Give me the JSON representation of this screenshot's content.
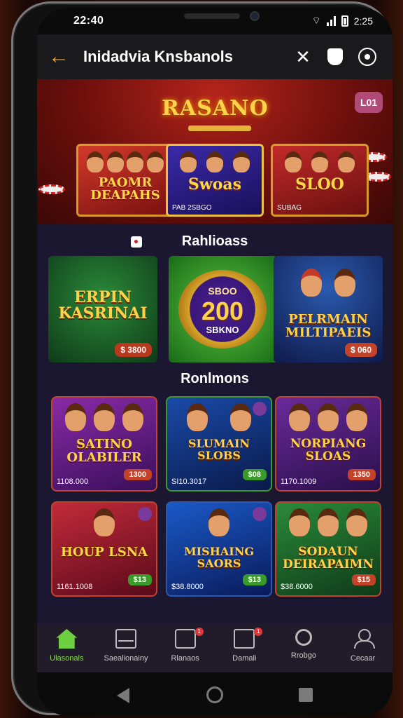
{
  "status": {
    "time": "22:40",
    "right_text": "2:25"
  },
  "appbar": {
    "title": "Inidadvia Knsbanols"
  },
  "banner": {
    "logo": "RASANO",
    "badge": "L01",
    "promos": [
      {
        "title": "PAOMR DEAPAHS",
        "caption": ""
      },
      {
        "title": "Swoas",
        "caption": "PAB 2SBGO"
      },
      {
        "title": "SLOO",
        "caption": "SUBAG"
      }
    ]
  },
  "featured": {
    "heading": "Rahlioass",
    "items": [
      {
        "title": "ERPIN KASRINAI",
        "price": "$ 3800"
      },
      {
        "disc_top": "SBOO",
        "disc_value": "200",
        "disc_bottom": "SBKNO"
      },
      {
        "title": "PELRMAIN MILTIPAEIS",
        "price": "$ 060"
      }
    ]
  },
  "grid": {
    "heading": "Ronlmons",
    "cards": [
      {
        "title": "SATINO OLABILER",
        "caption": "1108.000",
        "price": "1300",
        "price_color": "#c2432a"
      },
      {
        "title": "SLUMAIN SLOBS",
        "caption": "SI10.3017",
        "price": "$08",
        "price_color": "#3a9a2a"
      },
      {
        "title": "NORPIANG SLOAS",
        "caption": "1170.1009",
        "price": "1350",
        "price_color": "#c2432a"
      },
      {
        "title": "HOUP LSNA",
        "caption": "1161.1008",
        "price": "$13",
        "price_color": "#3a9a2a"
      },
      {
        "title": "MISHAING SAORS",
        "caption": "$38.8000",
        "price": "$13",
        "price_color": "#3a9a2a"
      },
      {
        "title": "SODAUN DEIRAPAIMN",
        "caption": "$38.6000",
        "price": "$15",
        "price_color": "#c2432a"
      }
    ]
  },
  "nav": {
    "items": [
      {
        "label": "Ulasonals",
        "icon": "home-icon"
      },
      {
        "label": "Saealionainy",
        "icon": "envelope-icon"
      },
      {
        "label": "Rlanaos",
        "icon": "lock-icon",
        "badge": "1"
      },
      {
        "label": "Damali",
        "icon": "card-icon",
        "badge": "1"
      },
      {
        "label": "Rrobgo",
        "icon": "search-icon"
      },
      {
        "label": "Cecaar",
        "icon": "user-icon"
      }
    ]
  }
}
